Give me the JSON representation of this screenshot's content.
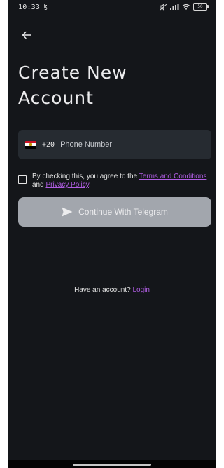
{
  "status_bar": {
    "time": "10:33",
    "notification_glyph": "ɮ",
    "battery": "50"
  },
  "icons": {
    "back": "arrow-left-icon",
    "flag": "egypt-flag-icon",
    "send": "send-icon",
    "signal": "signal-icon",
    "wifi": "wifi-icon",
    "battery": "battery-icon"
  },
  "title": "Create New Account",
  "phone_field": {
    "dial_code": "+20",
    "placeholder": "Phone Number",
    "value": ""
  },
  "terms": {
    "prefix": "By checking this, you agree to the ",
    "terms_link": "Terms and Conditions",
    "middle": " and ",
    "privacy_link": "Privacy Policy",
    "suffix": "."
  },
  "telegram_button": {
    "label": "Continue With Telegram"
  },
  "login": {
    "prompt": "Have an account? ",
    "link": "Login"
  },
  "colors": {
    "background": "#14161a",
    "field": "#262b31",
    "button_disabled": "#a2a6ad",
    "accent": "#b05de3"
  }
}
